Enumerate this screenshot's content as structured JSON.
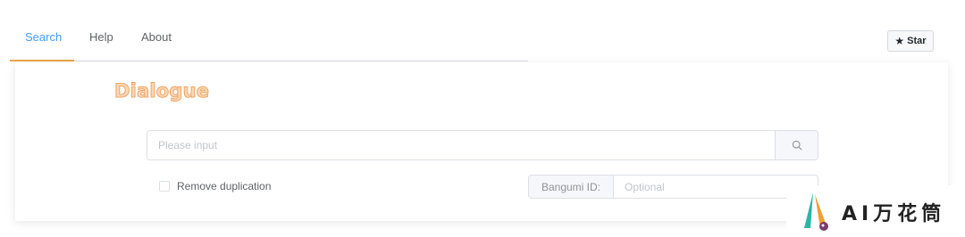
{
  "tabs": [
    {
      "label": "Search",
      "active": true
    },
    {
      "label": "Help",
      "active": false
    },
    {
      "label": "About",
      "active": false
    }
  ],
  "star_button": {
    "label": "Star",
    "icon": "star-icon"
  },
  "card": {
    "title": "Dialogue",
    "search": {
      "placeholder": "Please input",
      "value": "",
      "button_icon": "search-icon"
    },
    "remove_duplication": {
      "label": "Remove duplication",
      "checked": false
    },
    "bangumi": {
      "prepend_label": "Bangumi ID:",
      "placeholder": "Optional",
      "value": ""
    }
  },
  "watermark": {
    "text": "AI万花筒"
  },
  "colors": {
    "active_tab": "#409eff",
    "tab_indicator": "#f0a44a",
    "title_fill": "#fbd7b8",
    "title_stroke": "#f0a45e",
    "border": "#dcdfe6",
    "placeholder": "#c0c4cc"
  }
}
